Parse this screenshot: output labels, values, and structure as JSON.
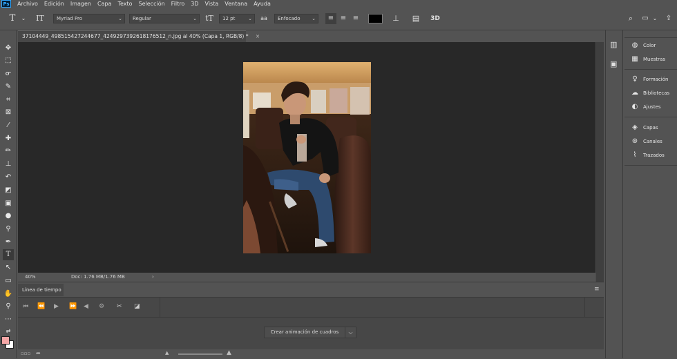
{
  "menu": {
    "logo": "Ps",
    "items": [
      "Archivo",
      "Edición",
      "Imagen",
      "Capa",
      "Texto",
      "Selección",
      "Filtro",
      "3D",
      "Vista",
      "Ventana",
      "Ayuda"
    ]
  },
  "options": {
    "font_family": "Myriad Pro",
    "font_style": "Regular",
    "font_size": "12 pt",
    "antialias_icon_label": "aa",
    "antialias": "Enfocado",
    "color_swatch": "#000000",
    "three_d_label": "3D"
  },
  "document": {
    "tab_title": "37104449_498515427244677_4249297392618176512_n.jpg al 40% (Capa 1, RGB/8) *",
    "close_glyph": "×",
    "zoom": "40%",
    "doc_size": "Doc: 1.76 MB/1.76 MB",
    "status_arrow": "›"
  },
  "timeline": {
    "tab": "Línea de tiempo",
    "create_button": "Crear animación de cuadros",
    "dropdown_glyph": "⌵"
  },
  "right_panels": {
    "group1": [
      {
        "icon": "color-icon",
        "label": "Color"
      },
      {
        "icon": "swatches-icon",
        "label": "Muestras"
      }
    ],
    "group2": [
      {
        "icon": "learn-icon",
        "label": "Formación"
      },
      {
        "icon": "libraries-icon",
        "label": "Bibliotecas"
      },
      {
        "icon": "adjustments-icon",
        "label": "Ajustes"
      }
    ],
    "group3": [
      {
        "icon": "layers-icon",
        "label": "Capas"
      },
      {
        "icon": "channels-icon",
        "label": "Canales"
      },
      {
        "icon": "paths-icon",
        "label": "Trazados"
      }
    ]
  },
  "colors": {
    "foreground": "#f4a6a6",
    "background": "#ffffff"
  }
}
